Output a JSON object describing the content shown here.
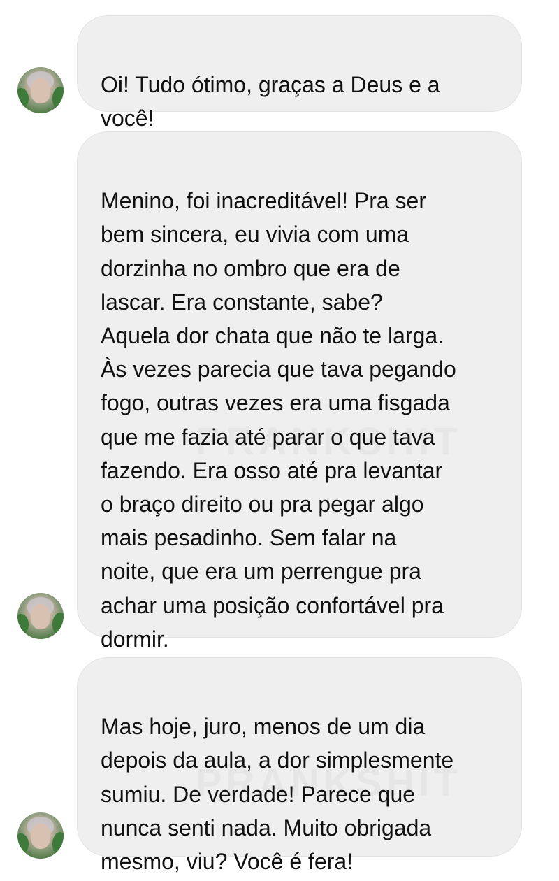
{
  "messages": [
    {
      "sender_avatar": "user-avatar",
      "text": "Oi! Tudo ótimo, graças a Deus e a\nvocê!"
    },
    {
      "sender_avatar": "user-avatar",
      "text": "Menino, foi inacreditável! Pra ser\nbem sincera, eu vivia com uma\ndorzinha no ombro que era de\nlascar. Era constante, sabe?\nAquela dor chata que não te larga.\nÀs vezes parecia que tava pegando\nfogo, outras vezes era uma fisgada\nque me fazia até parar o que tava\nfazendo. Era osso até pra levantar\no braço direito ou pra pegar algo\nmais pesadinho. Sem falar na\nnoite, que era um perrengue pra\nachar uma posição confortável pra\ndormir."
    },
    {
      "sender_avatar": "user-avatar",
      "text": "Mas hoje, juro, menos de um dia\ndepois da aula, a dor simplesmente\nsumiu. De verdade! Parece que\nnunca senti nada. Muito obrigada\nmesmo, viu? Você é fera!"
    }
  ],
  "watermark": "PRANKSHIT",
  "colors": {
    "bubble_bg": "#efefef",
    "text": "#111111",
    "background": "#ffffff"
  }
}
